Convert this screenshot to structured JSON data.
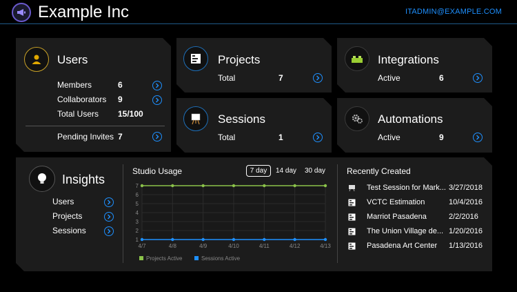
{
  "header": {
    "title": "Example Inc",
    "account": "ITADMIN@EXAMPLE.COM"
  },
  "users": {
    "title": "Users",
    "members_label": "Members",
    "members_value": "6",
    "collaborators_label": "Collaborators",
    "collaborators_value": "9",
    "total_label": "Total Users",
    "total_value": "15/100",
    "pending_label": "Pending Invites",
    "pending_value": "7"
  },
  "projects": {
    "title": "Projects",
    "label": "Total",
    "value": "7"
  },
  "integrations": {
    "title": "Integrations",
    "label": "Active",
    "value": "6"
  },
  "sessions": {
    "title": "Sessions",
    "label": "Total",
    "value": "1"
  },
  "automations": {
    "title": "Automations",
    "label": "Active",
    "value": "9"
  },
  "insights": {
    "title": "Insights",
    "links": [
      "Users",
      "Projects",
      "Sessions"
    ]
  },
  "usage": {
    "title": "Studio Usage",
    "ranges": [
      "7 day",
      "14 day",
      "30 day"
    ],
    "selected_range": "7 day"
  },
  "chart_data": {
    "type": "line",
    "title": "Studio Usage",
    "x": [
      "4/7",
      "4/8",
      "4/9",
      "4/10",
      "4/11",
      "4/12",
      "4/13"
    ],
    "ylim": [
      1,
      7
    ],
    "yticks": [
      1,
      2,
      3,
      4,
      5,
      6,
      7
    ],
    "grid": true,
    "legend": "bottom",
    "series": [
      {
        "name": "Projects Active",
        "values": [
          7,
          7,
          7,
          7,
          7,
          7,
          7
        ],
        "color": "#8bc34a"
      },
      {
        "name": "Sessions Active",
        "values": [
          1,
          1,
          1,
          1,
          1,
          1,
          1
        ],
        "color": "#1e90ff"
      }
    ]
  },
  "recent": {
    "title": "Recently Created",
    "items": [
      {
        "name": "Test Session for Mark...",
        "date": "3/27/2018",
        "icon": "session-icon"
      },
      {
        "name": "VCTC Estimation",
        "date": "10/4/2016",
        "icon": "project-icon"
      },
      {
        "name": "Marriot Pasadena",
        "date": "2/2/2016",
        "icon": "project-icon"
      },
      {
        "name": "The Union Village de...",
        "date": "1/20/2016",
        "icon": "project-icon"
      },
      {
        "name": "Pasadena Art Center",
        "date": "1/13/2016",
        "icon": "project-icon"
      }
    ]
  },
  "colors": {
    "accent": "#1e90ff",
    "card": "#1c1c1c",
    "projects_line": "#8bc34a",
    "sessions_line": "#1e90ff"
  }
}
